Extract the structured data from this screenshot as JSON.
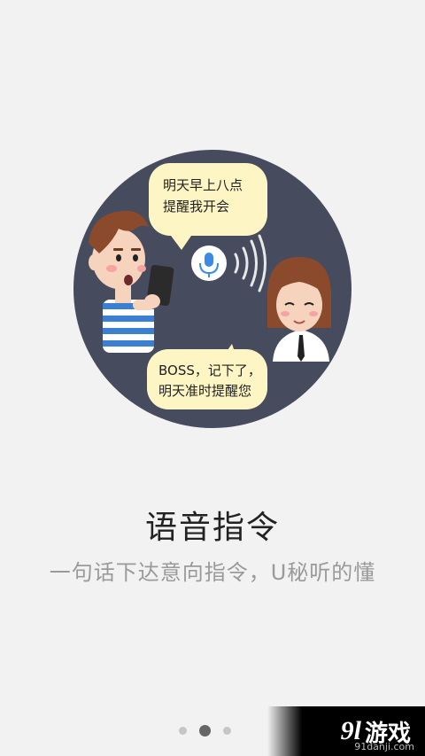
{
  "illustration": {
    "bubble_top": [
      "明天早上八点",
      "提醒我开会"
    ],
    "bubble_bottom": [
      "BOSS，记下了，",
      "明天准时提醒您"
    ],
    "circle_color": "#474b5e",
    "bubble_color": "#fdf6c4",
    "mic_color": "#3a8be6"
  },
  "title": "语音指令",
  "subtitle": "一句话下达意向指令，U秘听的懂",
  "pager": {
    "count": 3,
    "active_index": 1
  },
  "watermark": {
    "number": "9l",
    "name": "游戏",
    "url": "91danji.com"
  }
}
